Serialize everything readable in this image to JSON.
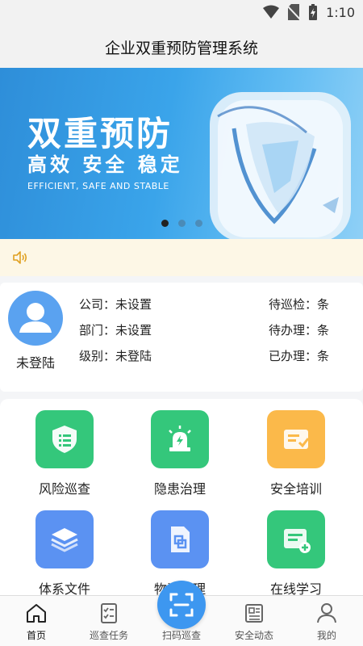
{
  "status_bar": {
    "time": "1:10"
  },
  "header": {
    "title": "企业双重预防管理系统"
  },
  "banner": {
    "title": "双重预防",
    "subtitle": "高效 安全 稳定",
    "english": "EFFICIENT, SAFE AND STABLE",
    "page_count": 3,
    "active_page": 1
  },
  "notice": {
    "icon": "speaker-icon",
    "text": ""
  },
  "profile": {
    "login_label": "未登陆",
    "company_label": "公司：",
    "company_value": "未设置",
    "department_label": "部门：",
    "department_value": "未设置",
    "level_label": "级别：",
    "level_value": "未登陆",
    "pending_inspection_label": "待巡检：",
    "pending_inspection_value": "条",
    "pending_handle_label": "待办理：",
    "pending_handle_value": "条",
    "handled_label": "已办理：",
    "handled_value": "条"
  },
  "modules": [
    {
      "label": "风险巡查",
      "icon": "shield-list-icon",
      "color": "#34c77b"
    },
    {
      "label": "隐患治理",
      "icon": "alarm-light-icon",
      "color": "#34c77b"
    },
    {
      "label": "安全培训",
      "icon": "certificate-icon",
      "color": "#fbb94a"
    },
    {
      "label": "体系文件",
      "icon": "layers-icon",
      "color": "#5b92f2"
    },
    {
      "label": "物资管理",
      "icon": "document-icon",
      "color": "#5b92f2"
    },
    {
      "label": "在线学习",
      "icon": "add-list-icon",
      "color": "#34c77b"
    }
  ],
  "tabs": [
    {
      "label": "首页",
      "icon": "home-icon"
    },
    {
      "label": "巡查任务",
      "icon": "checklist-icon"
    },
    {
      "label": "扫码巡查",
      "icon": "scan-icon"
    },
    {
      "label": "安全动态",
      "icon": "news-icon"
    },
    {
      "label": "我的",
      "icon": "user-icon"
    }
  ],
  "colors": {
    "primary": "#3d97f0",
    "green": "#34c77b",
    "orange": "#fbb94a",
    "notice_bg": "#fdf7e6"
  }
}
